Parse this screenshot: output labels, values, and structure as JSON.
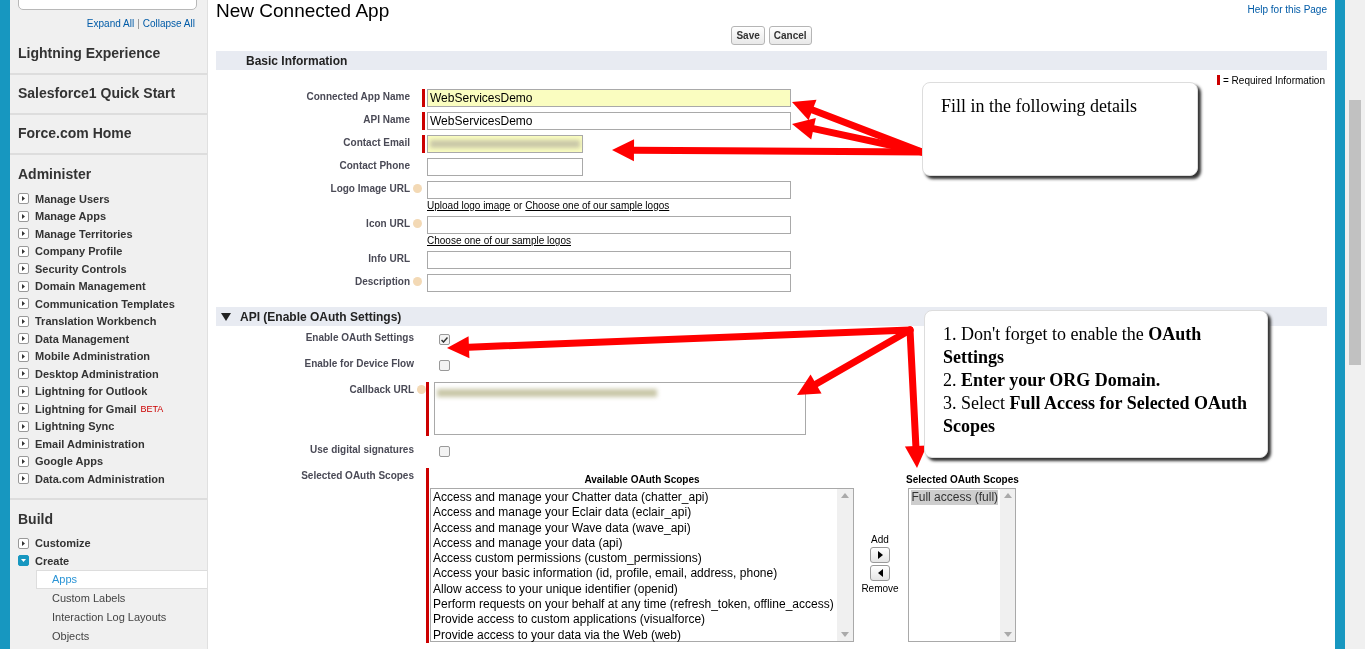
{
  "sidebar": {
    "links": [
      "Expand All",
      "Collapse All"
    ],
    "links_separator": "|",
    "top_items": [
      "Lightning Experience",
      "Salesforce1 Quick Start",
      "Force.com Home"
    ],
    "groups": [
      {
        "title": "Administer",
        "items": [
          {
            "label": "Manage Users",
            "expanded": false
          },
          {
            "label": "Manage Apps",
            "expanded": false
          },
          {
            "label": "Manage Territories",
            "expanded": false
          },
          {
            "label": "Company Profile",
            "expanded": false
          },
          {
            "label": "Security Controls",
            "expanded": false
          },
          {
            "label": "Domain Management",
            "expanded": false
          },
          {
            "label": "Communication Templates",
            "expanded": false
          },
          {
            "label": "Translation Workbench",
            "expanded": false
          },
          {
            "label": "Data Management",
            "expanded": false
          },
          {
            "label": "Mobile Administration",
            "expanded": false
          },
          {
            "label": "Desktop Administration",
            "expanded": false
          },
          {
            "label": "Lightning for Outlook",
            "expanded": false
          },
          {
            "label": "Lightning for Gmail",
            "badge": "BETA",
            "expanded": false
          },
          {
            "label": "Lightning Sync",
            "expanded": false
          },
          {
            "label": "Email Administration",
            "expanded": false
          },
          {
            "label": "Google Apps",
            "expanded": false
          },
          {
            "label": "Data.com Administration",
            "expanded": false
          }
        ]
      },
      {
        "title": "Build",
        "items": [
          {
            "label": "Customize",
            "expanded": false
          },
          {
            "label": "Create",
            "expanded": true,
            "children": [
              {
                "label": "Apps",
                "selected": true
              },
              {
                "label": "Custom Labels",
                "selected": false
              },
              {
                "label": "Interaction Log Layouts",
                "selected": false
              },
              {
                "label": "Objects",
                "selected": false
              }
            ]
          }
        ]
      }
    ]
  },
  "page": {
    "title": "New Connected App",
    "help_link": "Help for this Page",
    "buttons": [
      "Save",
      "Cancel"
    ],
    "required_legend": "= Required Information"
  },
  "basic_section": {
    "title": "Basic Information",
    "fields": [
      {
        "label": "Connected App Name",
        "kind": "long",
        "required": true,
        "help": false,
        "value": "WebServicesDemo",
        "highlighted": true,
        "blurred": false
      },
      {
        "label": "API Name",
        "kind": "long",
        "required": true,
        "help": false,
        "value": "WebServicesDemo",
        "highlighted": false,
        "blurred": false
      },
      {
        "label": "Contact Email",
        "kind": "short",
        "required": true,
        "help": false,
        "highlighted": true,
        "blurred": true
      },
      {
        "label": "Contact Phone",
        "kind": "short",
        "required": false,
        "help": false,
        "highlighted": false,
        "blurred": false
      },
      {
        "label": "Logo Image URL",
        "kind": "long",
        "required": false,
        "help": true,
        "highlighted": false,
        "blurred": false,
        "links": [
          "Upload logo image",
          "Choose one of our sample logos"
        ],
        "links_joiner": "or"
      },
      {
        "label": "Icon URL",
        "kind": "long",
        "required": false,
        "help": true,
        "highlighted": false,
        "blurred": false,
        "links": [
          "Choose one of our sample logos"
        ]
      },
      {
        "label": "Info URL",
        "kind": "long",
        "required": false,
        "help": false,
        "highlighted": false,
        "blurred": false
      },
      {
        "label": "Description",
        "kind": "long",
        "required": false,
        "help": true,
        "highlighted": false,
        "blurred": false
      }
    ]
  },
  "api_section": {
    "title": "API (Enable OAuth Settings)",
    "expanded": true,
    "rows": [
      {
        "kind": "checkbox",
        "label": "Enable OAuth Settings",
        "checked": true
      },
      {
        "kind": "checkbox",
        "label": "Enable for Device Flow",
        "checked": false
      },
      {
        "kind": "textarea",
        "label": "Callback URL",
        "required": true,
        "help": true,
        "blurred": true
      },
      {
        "kind": "checkbox",
        "label": "Use digital signatures",
        "checked": false
      }
    ],
    "scopes": {
      "label": "Selected OAuth Scopes",
      "required": true,
      "available_title": "Available OAuth Scopes",
      "available": [
        "Access and manage your Chatter data (chatter_api)",
        "Access and manage your Eclair data (eclair_api)",
        "Access and manage your Wave data (wave_api)",
        "Access and manage your data (api)",
        "Access custom permissions (custom_permissions)",
        "Access your basic information (id, profile, email, address, phone)",
        "Allow access to your unique identifier (openid)",
        "Perform requests on your behalf at any time (refresh_token, offline_access)",
        "Provide access to custom applications (visualforce)",
        "Provide access to your data via the Web (web)"
      ],
      "add_label": "Add",
      "remove_label": "Remove",
      "selected_title": "Selected OAuth Scopes",
      "selected": [
        {
          "label": "Full access (full)",
          "selected": true
        }
      ]
    }
  },
  "callouts": [
    {
      "lines": [
        "Fill in the following details"
      ]
    },
    {
      "lines": [
        "1. Don't forget to enable the **OAuth Settings**",
        "2. **Enter your ORG Domain.**",
        "3. Select **Full Access for Selected OAuth Scopes**"
      ]
    }
  ]
}
